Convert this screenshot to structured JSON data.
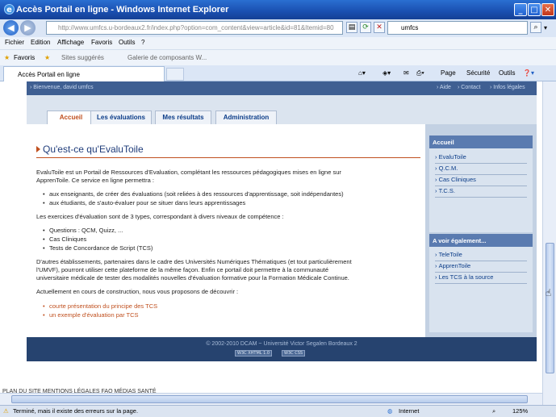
{
  "window": {
    "title": "Accès Portail en ligne - Windows Internet Explorer",
    "address": "http://www.umfcs.u-bordeaux2.fr/index.php?option=com_content&view=article&id=81&Itemid=80",
    "address_domain": "u-bordeaux2.fr",
    "search_text": "umfcs"
  },
  "menu": [
    "Fichier",
    "Edition",
    "Affichage",
    "Favoris",
    "Outils",
    "?"
  ],
  "favorites": {
    "label": "Favoris",
    "items": [
      "Sites suggérés",
      "Galerie de composants W..."
    ]
  },
  "tab": {
    "label": "Accès Portail en ligne"
  },
  "command_bar": {
    "page": "Page",
    "security": "Sécurité",
    "tools": "Outils"
  },
  "site": {
    "welcome": "› Bienvenue, david umfcs",
    "top_links": [
      "› Aide",
      "› Contact",
      "› Infos légales"
    ],
    "tabs": [
      "Accueil",
      "Les évaluations",
      "Mes résultats",
      "Administration"
    ],
    "heading": "Qu'est-ce qu'EvaluToile",
    "intro": [
      "EvaluToile est un Portail de Ressources d'Evaluation, complétant les ressources pédagogiques mises en ligne sur",
      "ApprenToile. Ce service en ligne permettra :"
    ],
    "intro_items": [
      "aux enseignants, de créer des évaluations (soit reliées à des ressources d'apprentissage, soit indépendantes)",
      "aux étudiants, de s'auto-évaluer pour se situer dans leurs apprentissages"
    ],
    "types_text": "Les exercices d'évaluation sont de 3 types, correspondant à divers niveaux de compétence :",
    "types_items": [
      "Questions : QCM, Quizz, ...",
      "Cas Cliniques",
      "Tests de Concordance de Script (TCS)"
    ],
    "partners": [
      "D'autres établissements, partenaires dans le cadre des Universités Numériques Thématiques (et tout particulièrement",
      "l'UMVF), pourront utiliser cette plateforme de la même façon. Enfin ce portail doit permettre à la communauté",
      "universitaire médicale de tester des modalités nouvelles d'évaluation formative pour la Formation Médicale Continue."
    ],
    "construction": "Actuellement en cours de construction, nous vous proposons de découvrir :",
    "links": [
      "courte présentation du principe des TCS",
      "un exemple d'évaluation par TCS"
    ],
    "sidebar": {
      "accueil_title": "Accueil",
      "accueil_items": [
        "EvaluToile",
        "Q.C.M.",
        "Cas Cliniques",
        "T.C.S."
      ],
      "see_also_title": "A voir également...",
      "see_also_items": [
        "TeleToile",
        "ApprenToile",
        "Les TCS à la source"
      ]
    },
    "footer": "© 2002-2010 DCAM ~ Université Victor Segalen Bordeaux 2",
    "w3c_badges": [
      "W3C XHTML 1.0",
      "W3C CSS"
    ],
    "below_links": "PLAN DU SITE     MENTIONS LÉGALES     FAQ     MÉDIAS SANTÉ"
  },
  "status": {
    "message": "Terminé, mais il existe des erreurs sur la page.",
    "zone": "Internet",
    "zoom": "125%"
  }
}
